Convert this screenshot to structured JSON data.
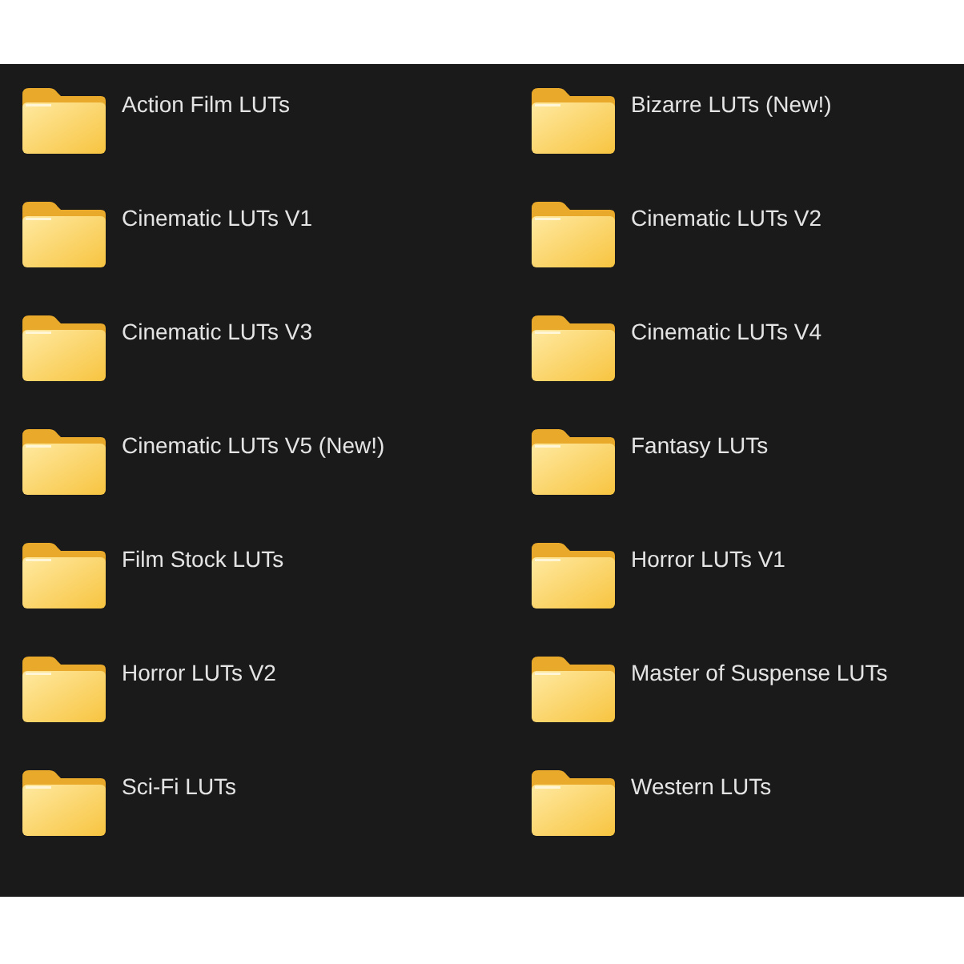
{
  "folders": [
    {
      "name": "Action Film LUTs"
    },
    {
      "name": "Bizarre LUTs (New!)"
    },
    {
      "name": "Cinematic LUTs V1"
    },
    {
      "name": "Cinematic LUTs V2"
    },
    {
      "name": "Cinematic LUTs V3"
    },
    {
      "name": "Cinematic LUTs V4"
    },
    {
      "name": "Cinematic LUTs V5 (New!)"
    },
    {
      "name": "Fantasy LUTs"
    },
    {
      "name": "Film Stock LUTs"
    },
    {
      "name": "Horror LUTs V1"
    },
    {
      "name": "Horror LUTs V2"
    },
    {
      "name": "Master of Suspense LUTs"
    },
    {
      "name": "Sci-Fi LUTs"
    },
    {
      "name": "Western LUTs"
    }
  ]
}
